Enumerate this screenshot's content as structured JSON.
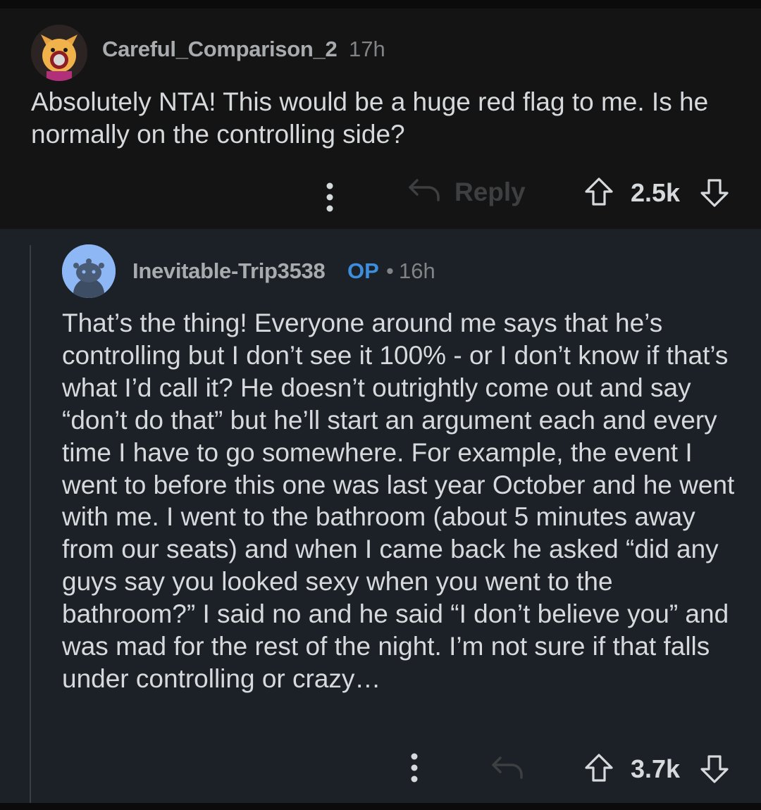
{
  "top_comment": {
    "username": "Careful_Comparison_2",
    "time": "17h",
    "body": "Absolutely NTA! This would be a huge red flag to me. Is he normally on the controlling side?",
    "reply_label": "Reply",
    "score": "2.5k",
    "avatar_icon": "fox-avatar-icon"
  },
  "reply_comment": {
    "username": "Inevitable-Trip3538",
    "op_badge": "OP",
    "separator": "•",
    "time": "16h",
    "body": "That’s the thing! Everyone around me says that he’s controlling but I don’t see it 100% - or I don’t know if that’s what I’d call it? He doesn’t outrightly come out and say “don’t do that” but he’ll start an argument each and every time I have to go somewhere. For example, the event I went to before this one was last year October and he went with me. I went to the bathroom (about 5 minutes away from our seats) and when I came back he asked “did any guys say you looked sexy when you went to the bathroom?” I said no and he said “I don’t believe you” and was mad for the rest of the night. I’m not sure if that falls under controlling or crazy…",
    "score": "3.7k",
    "avatar_icon": "snoo-avatar-icon"
  },
  "colors": {
    "top_bg": "#141415",
    "reply_bg": "#1c2128",
    "op_blue": "#3d8edd",
    "text": "#d7dadc",
    "muted": "#818384"
  }
}
